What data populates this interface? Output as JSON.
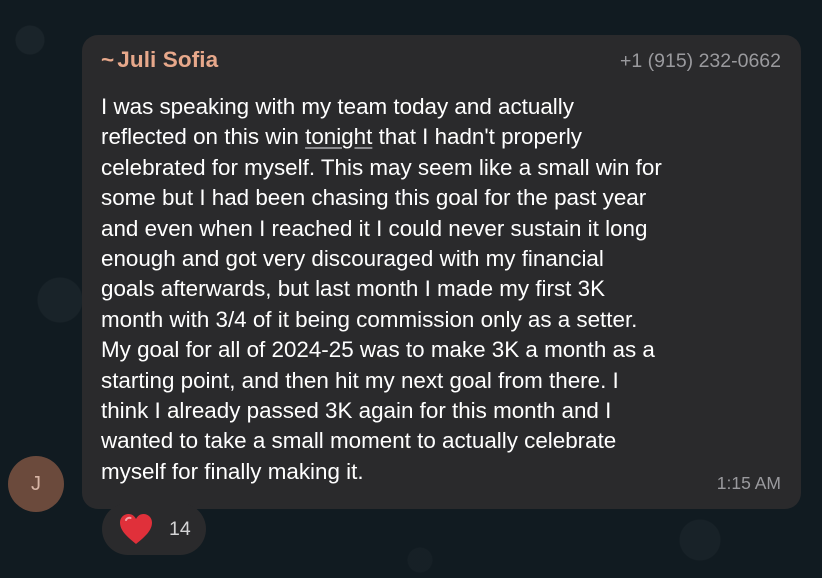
{
  "message": {
    "sender_prefix": "~",
    "sender_name": "Juli Sofia",
    "phone": "+1 (915) 232-0662",
    "lines": [
      "I was speaking with my team today and actually",
      [
        "reflected on this win ",
        "tonight",
        " that I hadn't properly"
      ],
      "celebrated for myself. This may seem like a small win for",
      "some but I had been chasing this goal for the past year",
      "and even when I reached it I could never sustain it long",
      "enough and got very discouraged with my financial",
      "goals afterwards, but last month I made my first 3K",
      "month with 3/4 of it being commission only as a setter.",
      "My goal for all of 2024-25 was to make 3K a month as a",
      "starting point, and then hit my next goal from there. I",
      "think I already passed 3K again for this month and I",
      "wanted to take a small moment to actually celebrate",
      "myself for finally making it."
    ],
    "time": "1:15 AM"
  },
  "avatar": {
    "initial": "J",
    "color": "#6b4a3c"
  },
  "reaction": {
    "icon": "heart-icon",
    "count": "14",
    "color": "#e0303a"
  }
}
